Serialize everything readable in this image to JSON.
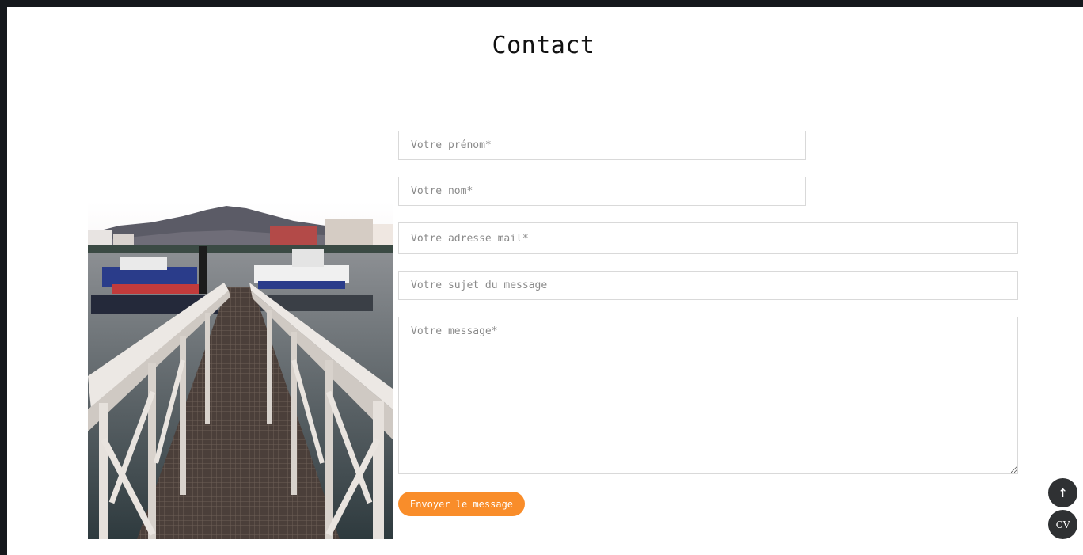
{
  "page": {
    "title": "Contact"
  },
  "form": {
    "first_name_placeholder": "Votre prénom*",
    "last_name_placeholder": "Votre nom*",
    "email_placeholder": "Votre adresse mail*",
    "subject_placeholder": "Votre sujet du message",
    "message_placeholder": "Votre message*",
    "submit_label": "Envoyer le message"
  },
  "floating": {
    "back_to_top_icon": "arrow-up-icon",
    "back_to_top_glyph": "↑",
    "cv_label": "CV"
  },
  "colors": {
    "accent": "#f98d2a",
    "fab_background": "#2f3133",
    "page_frame": "#15181c"
  }
}
